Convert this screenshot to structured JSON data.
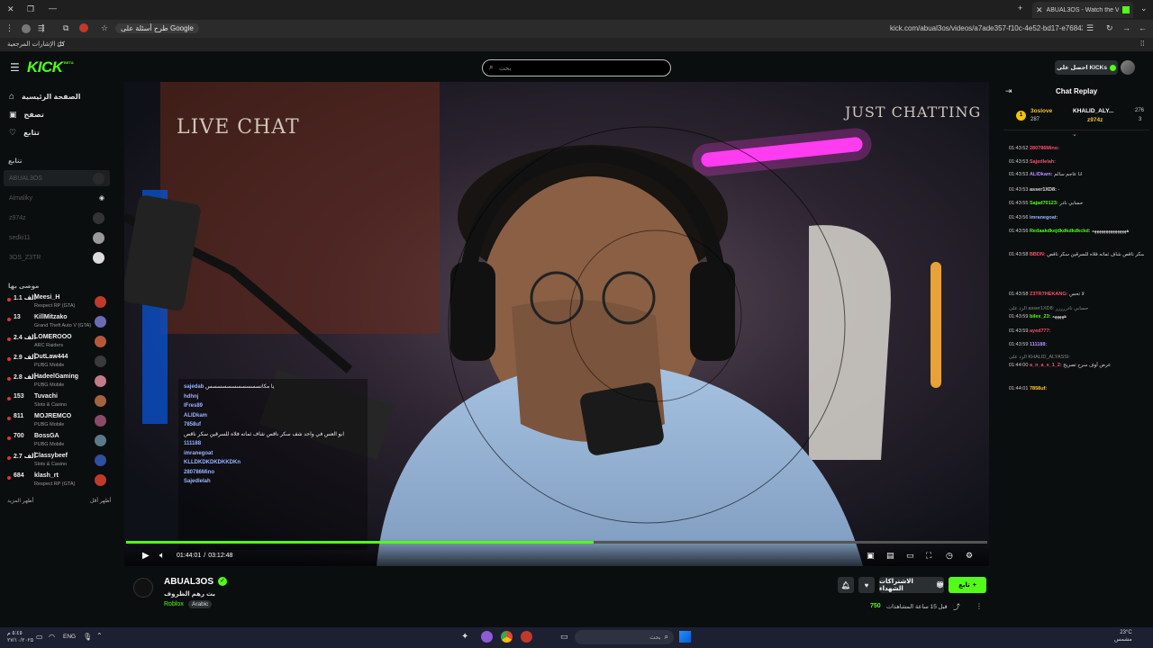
{
  "browser": {
    "tab_title": "ABUAL3OS - Watch the VO",
    "url": "kick.com/abual3os/videos/a7ade357-f10c-4e52-bd17-e76843e63874",
    "google_chip": "طرح أسئلة على Google",
    "bookmarks_label": "كل الإشارات المرجعية"
  },
  "header": {
    "logo": "KICK",
    "logo_badge": "BETA",
    "search_placeholder": "بحث",
    "get_kicks_label": "احصل على KICKs"
  },
  "sidebar": {
    "nav": [
      {
        "label": "الصفحة الرئيسية",
        "icon": "home-icon"
      },
      {
        "label": "تصفح",
        "icon": "browse-icon"
      },
      {
        "label": "تتابع",
        "icon": "heart-icon"
      }
    ],
    "following_title": "تتابع",
    "following": [
      {
        "name": "ABUAL3OS"
      },
      {
        "name": "Almaliky"
      },
      {
        "name": "z974z"
      },
      {
        "name": "sedki11"
      },
      {
        "name": "3OS_Z3TR"
      }
    ],
    "recommended_title": "موصى بها",
    "recommended": [
      {
        "name": "Meesi_H",
        "category": "Respect RP (GTA)",
        "viewers": "1.1 ألف",
        "color": "#c0392b"
      },
      {
        "name": "KillMitzako",
        "category": "Grand Theft Auto V (GTA)",
        "viewers": "13",
        "color": "#6b6bb5"
      },
      {
        "name": "LOMEROOO",
        "category": "ARC Raiders",
        "viewers": "2.4 ألف",
        "color": "#b5583a"
      },
      {
        "name": "OutLaw444",
        "category": "PUBG Mobile",
        "viewers": "2.9 ألف",
        "color": "#3a3a3a"
      },
      {
        "name": "HadeelGaming",
        "category": "PUBG Mobile",
        "viewers": "2.8 ألف",
        "color": "#c47a8a"
      },
      {
        "name": "Tuvachi",
        "category": "Slots & Casino",
        "viewers": "153",
        "color": "#a4623f"
      },
      {
        "name": "MOJREMCO",
        "category": "PUBG Mobile",
        "viewers": "811",
        "color": "#8a4a6a"
      },
      {
        "name": "BossGA",
        "category": "PUBG Mobile",
        "viewers": "700",
        "color": "#5a7a8a"
      },
      {
        "name": "Classybeef",
        "category": "Slots & Casino",
        "viewers": "2.7 ألف",
        "color": "#2f4f9f"
      },
      {
        "name": "klash_rt",
        "category": "Respect RP (GTA)",
        "viewers": "684",
        "color": "#c0392b"
      }
    ],
    "show_more": "أظهر المزيد",
    "show_less": "أظهر أقل"
  },
  "video": {
    "overlay_left": "LIVE CHAT",
    "overlay_right": "JUST CHATTING",
    "time_current": "01:44:01",
    "time_total": "03:12:48",
    "time_separator": "/",
    "progress": 0.543,
    "chat_overlay": [
      {
        "user": "sajedab",
        "text": "يا مكانسسسسسسسسسسس"
      },
      {
        "user": "hdhnj",
        "text": ""
      },
      {
        "user": "lFres89",
        "text": ""
      },
      {
        "user": "ALIDkam",
        "text": ""
      },
      {
        "user": "7858uf",
        "text": ""
      },
      {
        "user": "",
        "text": "ابو العس في واحد شف سكر ناقص شاف ثمانه فلاه للسرقين سكر ناقص"
      },
      {
        "user": "111188",
        "text": ""
      },
      {
        "user": "imranegoat",
        "text": ""
      },
      {
        "user": "KLLDKDKDKDKKDKn",
        "text": ""
      },
      {
        "user": "280786Mino",
        "text": ""
      },
      {
        "user": "Sajedlelah",
        "text": ""
      }
    ]
  },
  "chat": {
    "title": "Chat Replay",
    "leaderboard": [
      {
        "user": "3oslove",
        "value": "287"
      },
      {
        "user": "KHALID_ALY...",
        "value": "276"
      },
      {
        "user": "z974z",
        "value": "3"
      }
    ],
    "messages": [
      {
        "time": "01:43:52",
        "user": "280786Mino:",
        "text": "",
        "color": "#ff4d6a"
      },
      {
        "time": "01:43:53",
        "user": "Sajedlelah:",
        "text": "",
        "color": "#ff4d6a"
      },
      {
        "time": "01:43:53",
        "user": "ALIDkam:",
        "text": "انا عاجم سالم",
        "color": "#b28cff"
      },
      {
        "time": "01:43:53",
        "user": "asser1XD8:",
        "text": "-",
        "color": "#dddddd"
      },
      {
        "time": "01:43:55",
        "user": "Sajad70123:",
        "text": "حسابي نادر",
        "color": "#53fc18"
      },
      {
        "time": "01:43:56",
        "user": "imranegoat:",
        "text": "",
        "color": "#9ab4ff"
      },
      {
        "time": "01:43:56",
        "user": "Redaakdkejdkdkdkdkckd:",
        "text": "هههههههههههههههه",
        "color": "#53fc18"
      },
      {
        "time": "01:43:58",
        "user": "BBDN:",
        "text": "ابو العس في واحد شاف سكر ناقص شاف ثمانه فلاه للسرقين سكر ناقص",
        "color": "#ff4d6a"
      },
      {
        "time": "01:43:58",
        "user": "Z3TR7HEKANG:",
        "text": "لا تحس",
        "color": "#ff4d6a"
      },
      {
        "time": "01:43:59",
        "user": "bilex_23:",
        "text": "هههههه",
        "color": "#53fc18"
      },
      {
        "time": "01:43:59",
        "user": "ayed777:",
        "text": "",
        "color": "#ff4d6a"
      },
      {
        "time": "01:43:59",
        "user": "111188:",
        "text": "",
        "color": "#b28cff"
      },
      {
        "time": "01:44:00",
        "user": "a_n_a_s_1_2:",
        "text": "عرض آوف سرح تصريح",
        "color": "#ff4d6a"
      },
      {
        "time": "01:44:01",
        "user": "7858uf:",
        "text": "",
        "color": "#ffcc33"
      }
    ],
    "reply_1": "الرد على asser1XD8: حسابي نادررررر",
    "reply_2": "الرد على KHALID_ALYASSI:"
  },
  "channel": {
    "name": "ABUAL3OS",
    "stream_title": "بث رهم الظروف",
    "category": "Roblox",
    "language_tag": "Arabic",
    "viewers": "750",
    "viewers_label": "المشاهدات",
    "time_ago": "قبل 15 ساعة",
    "follow_label": "تابع",
    "subscribe_label": "الاشتراكات الشهداء"
  },
  "taskbar": {
    "search_placeholder": "بحث",
    "language": "ENG",
    "weather_temp": "23°C",
    "weather_text": "مشمس",
    "time": "٥:٤٥ م",
    "date": "٢٧/١٠/٢٠٢٥"
  },
  "colors": {
    "accent": "#53fc18",
    "background": "#0b0e0f"
  }
}
